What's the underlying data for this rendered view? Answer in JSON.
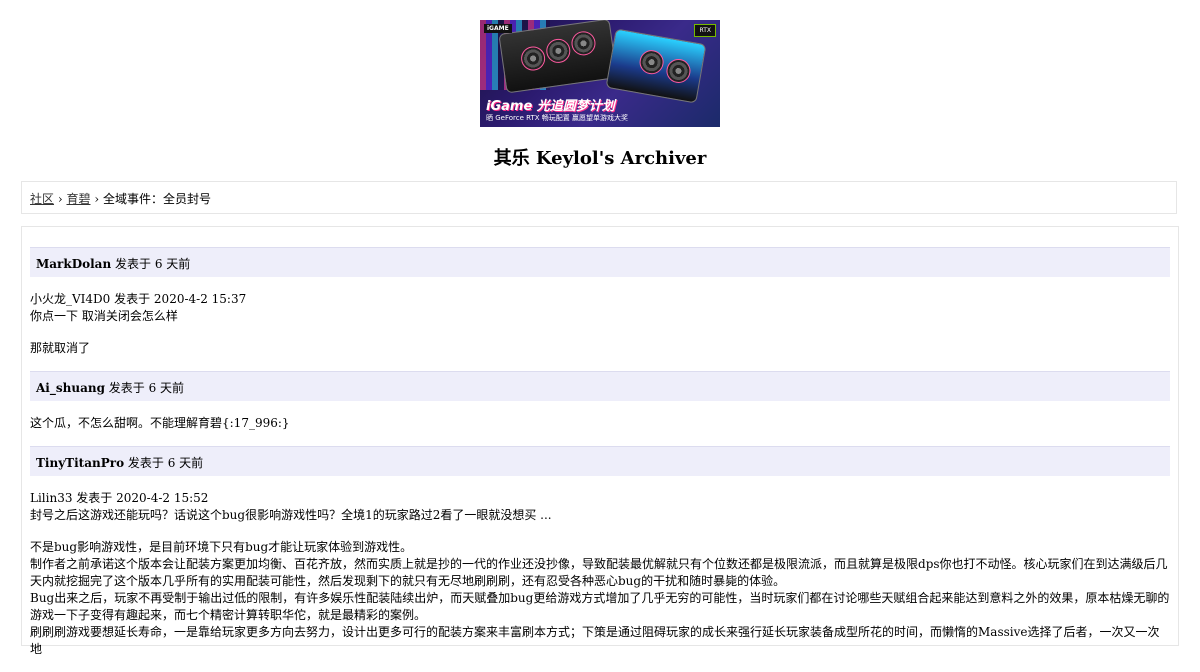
{
  "banner": {
    "brand_left": "iGAME",
    "brand_right": "RTX",
    "headline": "iGame 光追圆梦计划",
    "subline": "晒 GeForce RTX 畅玩配置 赢愿望单游戏大奖"
  },
  "site_title": "其乐 Keylol's Archiver",
  "breadcrumb": {
    "items": [
      "社区",
      "育碧"
    ],
    "separator": "›",
    "current": "全域事件：全员封号"
  },
  "posts": [
    {
      "author": "MarkDolan",
      "meta": "发表于 6 天前",
      "lines": [
        "小火龙_VI4D0 发表于 2020-4-2 15:37",
        "你点一下 取消关闭会怎么样",
        "",
        "那就取消了"
      ]
    },
    {
      "author": "Ai_shuang",
      "meta": "发表于 6 天前",
      "lines": [
        "这个瓜，不怎么甜啊。不能理解育碧{:17_996:}"
      ]
    },
    {
      "author": "TinyTitanPro",
      "meta": "发表于 6 天前",
      "lines": [
        "Lilin33 发表于 2020-4-2 15:52",
        "封号之后这游戏还能玩吗？话说这个bug很影响游戏性吗？全境1的玩家路过2看了一眼就没想买 ...",
        "",
        "不是bug影响游戏性，是目前环境下只有bug才能让玩家体验到游戏性。",
        "制作者之前承诺这个版本会让配装方案更加均衡、百花齐放，然而实质上就是抄的一代的作业还没抄像，导致配装最优解就只有个位数还都是极限流派，而且就算是极限dps你也打不动怪。核心玩家们在到达满级后几天内就挖掘完了这个版本几乎所有的实用配装可能性，然后发现剩下的就只有无尽地刷刷刷，还有忍受各种恶心bug的干扰和随时暴毙的体验。",
        "Bug出来之后，玩家不再受制于输出过低的限制，有许多娱乐性配装陆续出炉，而天赋叠加bug更给游戏方式增加了几乎无穷的可能性，当时玩家们都在讨论哪些天赋组合起来能达到意料之外的效果，原本枯燥无聊的游戏一下子变得有趣起来，而七个精密计算转职华佗，就是最精彩的案例。",
        "刷刷刷游戏要想延长寿命，一是靠给玩家更多方向去努力，设计出更多可行的配装方案来丰富刷本方式；下策是通过阻碍玩家的成长来强行延长玩家装备成型所花的时间，而懒惰的Massive选择了后者，一次又一次地"
      ]
    }
  ]
}
